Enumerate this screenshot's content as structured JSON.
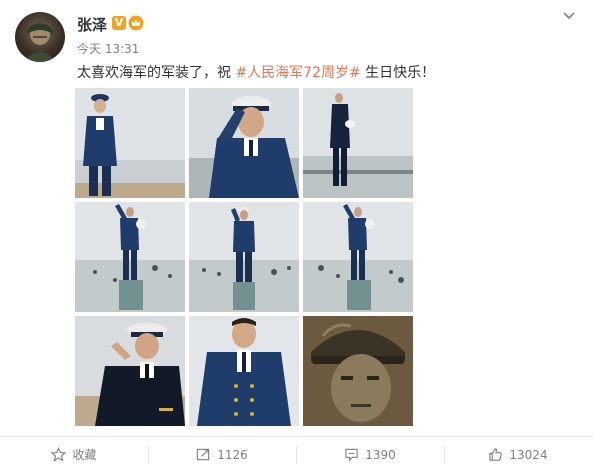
{
  "post": {
    "username": "张泽",
    "verified_badge": "V",
    "timestamp": "今天 13:31",
    "text_before": "太喜欢海军的军装了，祝 ",
    "hashtag": "#人民海军72周岁#",
    "text_after": " 生日快乐！"
  },
  "images": [
    {
      "name": "photo-navy-uniform-standing-beach"
    },
    {
      "name": "photo-navy-uniform-saluting"
    },
    {
      "name": "photo-navy-uniform-side-profile"
    },
    {
      "name": "photo-navy-saluting-on-rock-1"
    },
    {
      "name": "photo-navy-saluting-on-rock-2"
    },
    {
      "name": "photo-navy-saluting-on-rock-3"
    },
    {
      "name": "photo-navy-white-cap-salute"
    },
    {
      "name": "photo-navy-uniform-portrait"
    },
    {
      "name": "photo-helmet-portrait-sepia"
    }
  ],
  "actions": {
    "favorite_label": "收藏",
    "repost_count": "1126",
    "comment_count": "1390",
    "like_count": "13024"
  },
  "colors": {
    "hashtag": "#eb7350",
    "navy": "#1f3d6b",
    "badge": "#f4a11d"
  }
}
